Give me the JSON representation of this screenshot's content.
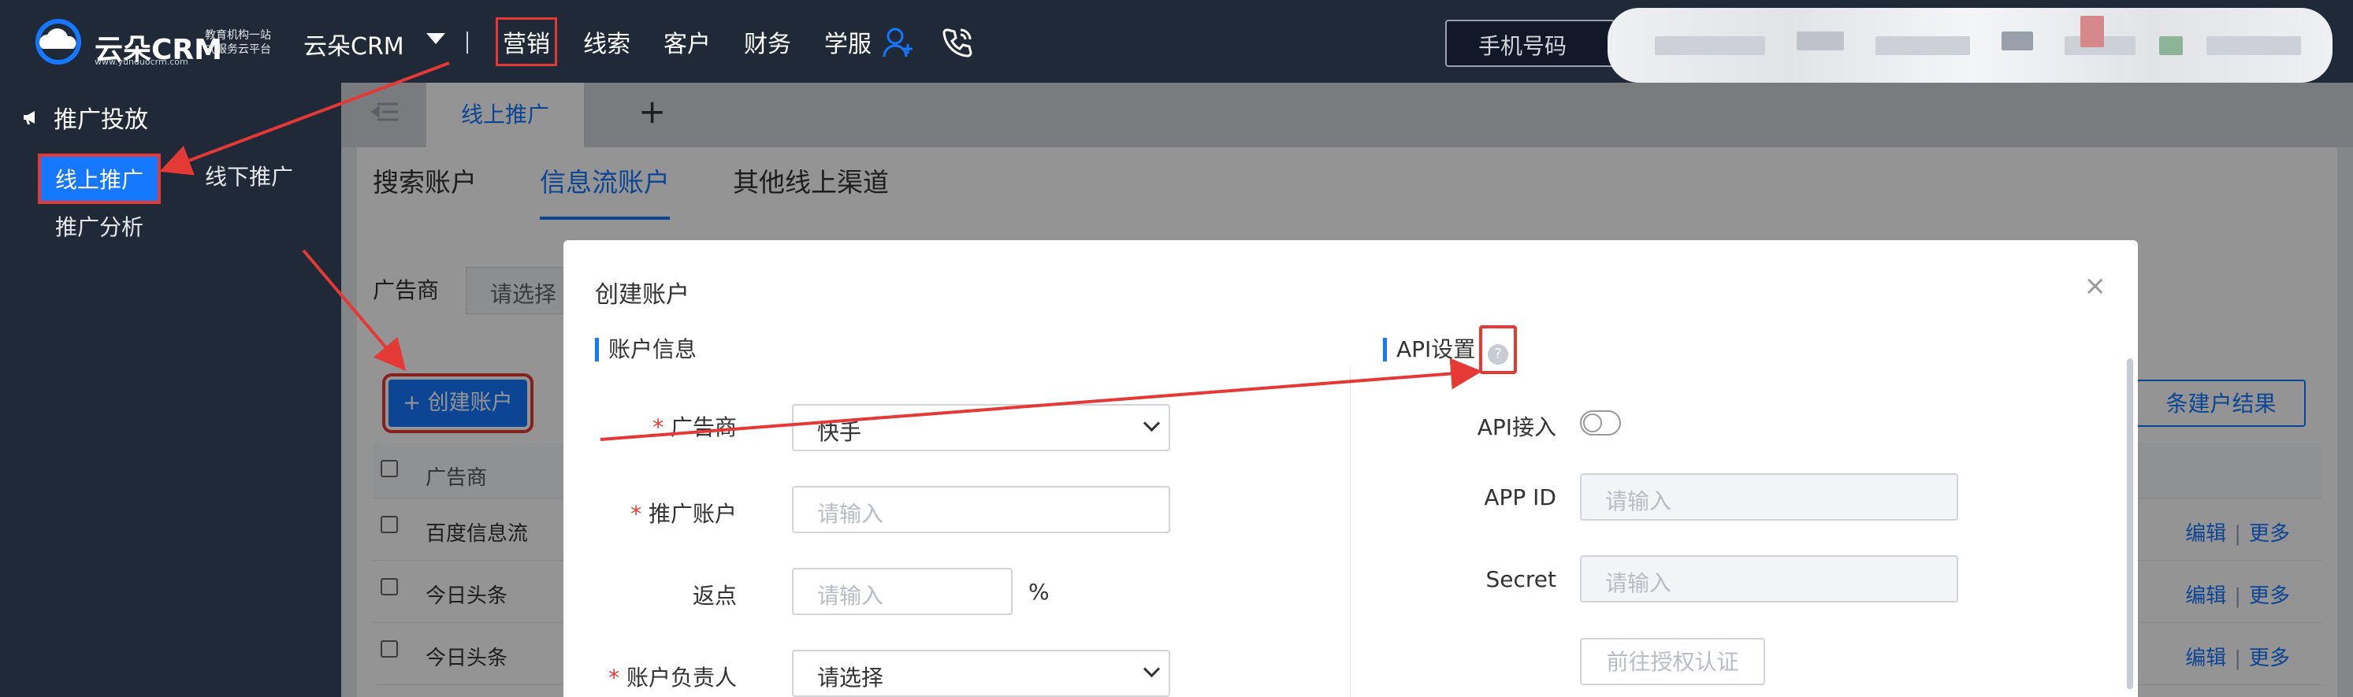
{
  "app": {
    "brand": "云朵CRM",
    "brand_sub": "www.yunduocrm.com",
    "slogan": "教育机构一站式服务云平台",
    "org_name": "云朵CRM"
  },
  "top_nav": {
    "items": [
      "营销",
      "线索",
      "客户",
      "财务",
      "学服"
    ],
    "active_index": 0,
    "phone_search_placeholder": "手机号码",
    "icons": [
      "user-add-icon",
      "phone-call-icon"
    ]
  },
  "sidebar": {
    "section_title": "推广投放",
    "section_icon": "megaphone-icon",
    "items": [
      "线上推广",
      "线下推广",
      "推广分析"
    ],
    "active_index": 0
  },
  "tabs": {
    "open_tab": "线上推广",
    "add_label": "+"
  },
  "page": {
    "sub_tabs": [
      "搜索账户",
      "信息流账户",
      "其他线上渠道"
    ],
    "active_sub_tab": 1,
    "filter_label": "广告商",
    "filter_placeholder": "请选择",
    "create_button": "+ 创建账户",
    "result_button": "条建户结果",
    "table": {
      "headers": [
        "广告商"
      ],
      "rows": [
        {
          "advertiser": "百度信息流",
          "edit": "编辑",
          "more": "更多"
        },
        {
          "advertiser": "今日头条",
          "edit": "编辑",
          "more": "更多"
        },
        {
          "advertiser": "今日头条",
          "edit": "编辑",
          "more": "更多"
        }
      ],
      "separator": "|"
    }
  },
  "modal": {
    "title": "创建账户",
    "close": "×",
    "left_section": "账户信息",
    "right_section": "API设置",
    "required_mark": "*",
    "fields": {
      "advertiser_label": "广告商",
      "advertiser_value": "快手",
      "account_label": "推广账户",
      "account_placeholder": "请输入",
      "rebate_label": "返点",
      "rebate_placeholder": "请输入",
      "rebate_unit": "%",
      "owner_label": "账户负责人",
      "owner_value": "请选择"
    },
    "api": {
      "access_label": "API接入",
      "access_enabled": false,
      "appid_label": "APP ID",
      "appid_placeholder": "请输入",
      "secret_label": "Secret",
      "secret_placeholder": "请输入",
      "auth_button": "前往授权认证",
      "help_icon": "question-circle-icon",
      "help_glyph": "?"
    }
  },
  "colors": {
    "primary": "#1677ff",
    "annotation": "#e53935",
    "dark_bg": "#1f2937"
  }
}
